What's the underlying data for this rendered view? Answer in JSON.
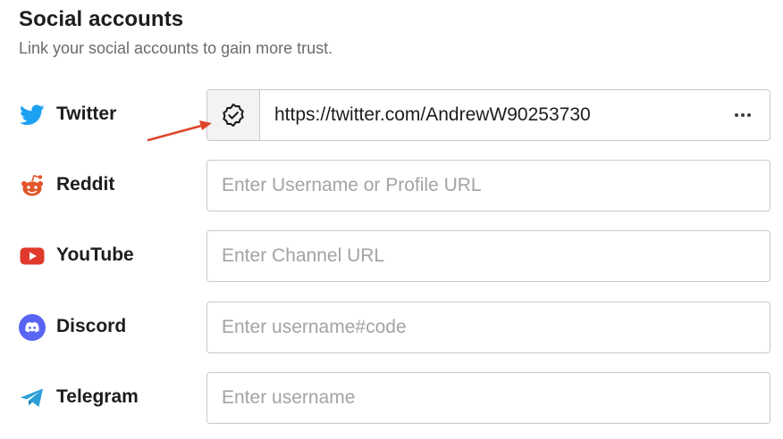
{
  "header": {
    "title": "Social accounts",
    "subtitle": "Link your social accounts to gain more trust."
  },
  "accounts": [
    {
      "name": "Twitter",
      "icon": "twitter-bird-icon",
      "value": "https://twitter.com/AndrewW90253730",
      "placeholder": "",
      "verified_icon": "verified-badge-icon",
      "more_icon": "more-horizontal-icon",
      "color": "#1da1f2"
    },
    {
      "name": "Reddit",
      "icon": "reddit-alien-icon",
      "value": "",
      "placeholder": "Enter Username or Profile URL",
      "color": "#e2562a"
    },
    {
      "name": "YouTube",
      "icon": "youtube-play-icon",
      "value": "",
      "placeholder": "Enter Channel URL",
      "color": "#e03a2d"
    },
    {
      "name": "Discord",
      "icon": "discord-icon",
      "value": "",
      "placeholder": "Enter username#code",
      "color": "#5865f2"
    },
    {
      "name": "Telegram",
      "icon": "telegram-plane-icon",
      "value": "",
      "placeholder": "Enter username",
      "color": "#2c9fd9"
    }
  ],
  "annotation": {
    "icon": "red-arrow-icon",
    "color": "#e0452b"
  }
}
